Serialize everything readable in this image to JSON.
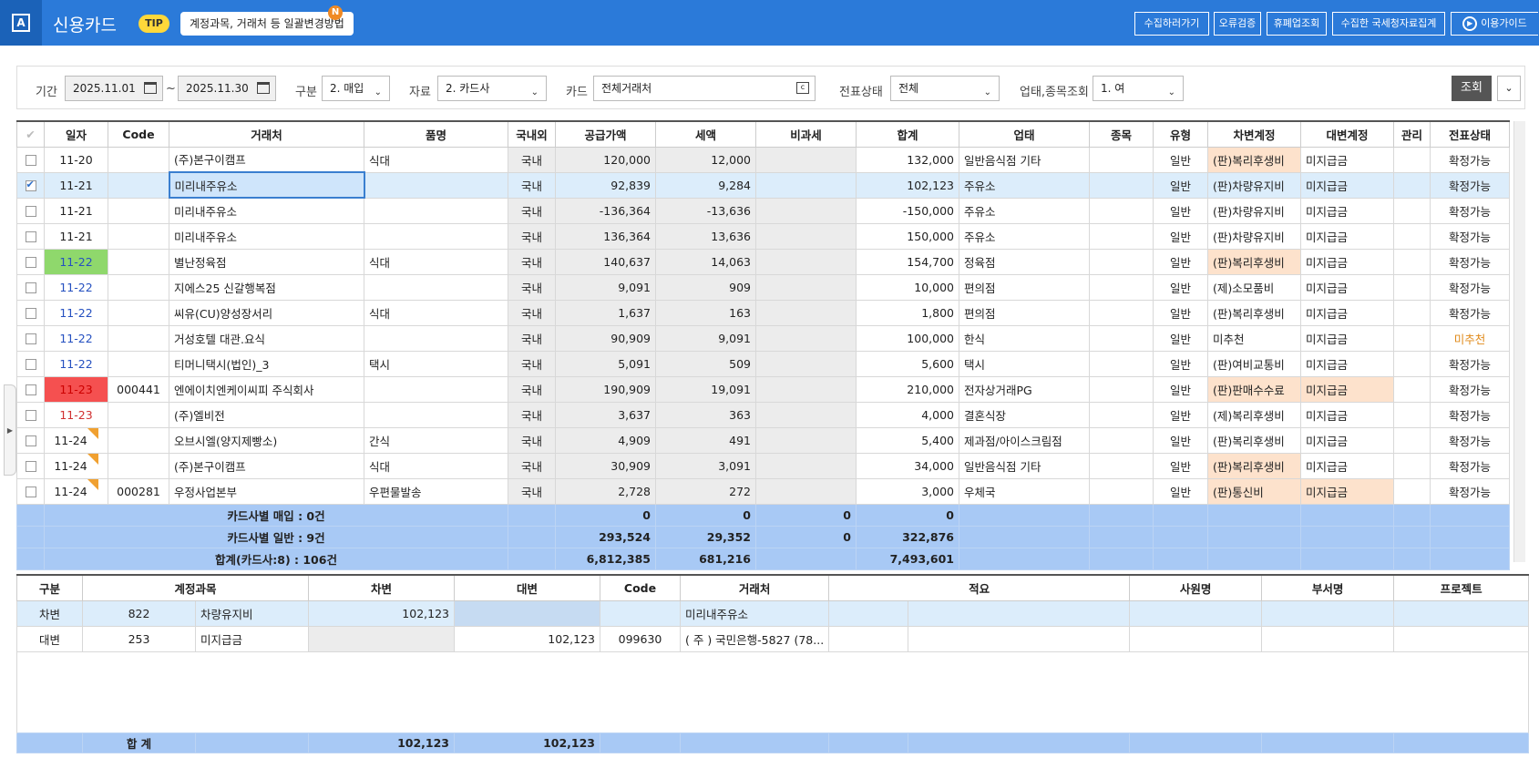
{
  "header": {
    "logo_letter": "A",
    "title": "신용카드",
    "tip_badge": "TIP",
    "tip_text": "계정과목, 거래처 등 일괄변경방법",
    "tip_new": "N",
    "buttons": [
      "수집하러가기",
      "오류검증",
      "휴폐업조회",
      "수집한 국세청자료집계",
      "이용가이드"
    ]
  },
  "filter": {
    "period_label": "기간",
    "date_from": "2025.11.01",
    "date_sep": "~",
    "date_to": "2025.11.30",
    "type_label": "구분",
    "type_value": "2. 매입",
    "source_label": "자료",
    "source_value": "2. 카드사",
    "card_label": "카드",
    "card_value": "전체거래처",
    "status_label": "전표상태",
    "status_value": "전체",
    "industry_label": "업태,종목조회",
    "industry_value": "1. 여",
    "search_button": "조회"
  },
  "grid": {
    "columns": [
      "일자",
      "Code",
      "거래처",
      "품명",
      "국내외",
      "공급가액",
      "세액",
      "비과세",
      "합계",
      "업태",
      "종목",
      "유형",
      "차변계정",
      "대변계정",
      "관리",
      "전표상태"
    ],
    "rows": [
      {
        "date": "11-20",
        "code": "",
        "vendor": "(주)본구이캠프",
        "item": "식대",
        "dom": "국내",
        "supply": "120,000",
        "tax": "12,000",
        "nontax": "",
        "total": "132,000",
        "biz": "일반음식점 기타",
        "kind": "",
        "type": "일반",
        "debit": "(판)복리후생비",
        "credit": "미지급금",
        "mgmt": "",
        "status": "확정가능"
      },
      {
        "date": "11-21",
        "code": "",
        "vendor": "미리내주유소",
        "item": "",
        "dom": "국내",
        "supply": "92,839",
        "tax": "9,284",
        "nontax": "",
        "total": "102,123",
        "biz": "주유소",
        "kind": "",
        "type": "일반",
        "debit": "(판)차량유지비",
        "credit": "미지급금",
        "mgmt": "",
        "status": "확정가능"
      },
      {
        "date": "11-21",
        "code": "",
        "vendor": "미리내주유소",
        "item": "",
        "dom": "국내",
        "supply": "-136,364",
        "tax": "-13,636",
        "nontax": "",
        "total": "-150,000",
        "biz": "주유소",
        "kind": "",
        "type": "일반",
        "debit": "(판)차량유지비",
        "credit": "미지급금",
        "mgmt": "",
        "status": "확정가능"
      },
      {
        "date": "11-21",
        "code": "",
        "vendor": "미리내주유소",
        "item": "",
        "dom": "국내",
        "supply": "136,364",
        "tax": "13,636",
        "nontax": "",
        "total": "150,000",
        "biz": "주유소",
        "kind": "",
        "type": "일반",
        "debit": "(판)차량유지비",
        "credit": "미지급금",
        "mgmt": "",
        "status": "확정가능"
      },
      {
        "date": "11-22",
        "code": "",
        "vendor": "별난정육점",
        "item": "식대",
        "dom": "국내",
        "supply": "140,637",
        "tax": "14,063",
        "nontax": "",
        "total": "154,700",
        "biz": "정육점",
        "kind": "",
        "type": "일반",
        "debit": "(판)복리후생비",
        "credit": "미지급금",
        "mgmt": "",
        "status": "확정가능"
      },
      {
        "date": "11-22",
        "code": "",
        "vendor": "지에스25 신갈행복점",
        "item": "",
        "dom": "국내",
        "supply": "9,091",
        "tax": "909",
        "nontax": "",
        "total": "10,000",
        "biz": "편의점",
        "kind": "",
        "type": "일반",
        "debit": "(제)소모품비",
        "credit": "미지급금",
        "mgmt": "",
        "status": "확정가능"
      },
      {
        "date": "11-22",
        "code": "",
        "vendor": "씨유(CU)양성장서리",
        "item": "식대",
        "dom": "국내",
        "supply": "1,637",
        "tax": "163",
        "nontax": "",
        "total": "1,800",
        "biz": "편의점",
        "kind": "",
        "type": "일반",
        "debit": "(판)복리후생비",
        "credit": "미지급금",
        "mgmt": "",
        "status": "확정가능"
      },
      {
        "date": "11-22",
        "code": "",
        "vendor": "거성호텔 대관.요식",
        "item": "",
        "dom": "국내",
        "supply": "90,909",
        "tax": "9,091",
        "nontax": "",
        "total": "100,000",
        "biz": "한식",
        "kind": "",
        "type": "일반",
        "debit": "미추천",
        "credit": "미지급금",
        "mgmt": "",
        "status": "미추천"
      },
      {
        "date": "11-22",
        "code": "",
        "vendor": "티머니택시(법인)_3",
        "item": "택시",
        "dom": "국내",
        "supply": "5,091",
        "tax": "509",
        "nontax": "",
        "total": "5,600",
        "biz": "택시",
        "kind": "",
        "type": "일반",
        "debit": "(판)여비교통비",
        "credit": "미지급금",
        "mgmt": "",
        "status": "확정가능"
      },
      {
        "date": "11-23",
        "code": "000441",
        "vendor": "엔에이치엔케이씨피 주식회사",
        "item": "",
        "dom": "국내",
        "supply": "190,909",
        "tax": "19,091",
        "nontax": "",
        "total": "210,000",
        "biz": "전자상거래PG",
        "kind": "",
        "type": "일반",
        "debit": "(판)판매수수료",
        "credit": "미지급금",
        "mgmt": "",
        "status": "확정가능"
      },
      {
        "date": "11-23",
        "code": "",
        "vendor": "(주)엘비전",
        "item": "",
        "dom": "국내",
        "supply": "3,637",
        "tax": "363",
        "nontax": "",
        "total": "4,000",
        "biz": "결혼식장",
        "kind": "",
        "type": "일반",
        "debit": "(제)복리후생비",
        "credit": "미지급금",
        "mgmt": "",
        "status": "확정가능"
      },
      {
        "date": "11-24",
        "code": "",
        "vendor": "오브시엘(양지제빵소)",
        "item": "간식",
        "dom": "국내",
        "supply": "4,909",
        "tax": "491",
        "nontax": "",
        "total": "5,400",
        "biz": "제과점/아이스크림점",
        "kind": "",
        "type": "일반",
        "debit": "(판)복리후생비",
        "credit": "미지급금",
        "mgmt": "",
        "status": "확정가능"
      },
      {
        "date": "11-24",
        "code": "",
        "vendor": "(주)본구이캠프",
        "item": "식대",
        "dom": "국내",
        "supply": "30,909",
        "tax": "3,091",
        "nontax": "",
        "total": "34,000",
        "biz": "일반음식점 기타",
        "kind": "",
        "type": "일반",
        "debit": "(판)복리후생비",
        "credit": "미지급금",
        "mgmt": "",
        "status": "확정가능"
      },
      {
        "date": "11-24",
        "code": "000281",
        "vendor": "우정사업본부",
        "item": "우편물발송",
        "dom": "국내",
        "supply": "2,728",
        "tax": "272",
        "nontax": "",
        "total": "3,000",
        "biz": "우체국",
        "kind": "",
        "type": "일반",
        "debit": "(판)통신비",
        "credit": "미지급금",
        "mgmt": "",
        "status": "확정가능"
      }
    ],
    "summary": [
      {
        "label": "카드사별  매입 : 0건",
        "supply": "0",
        "tax": "0",
        "nontax": "0",
        "total": "0"
      },
      {
        "label": "카드사별  일반 : 9건",
        "supply": "293,524",
        "tax": "29,352",
        "nontax": "0",
        "total": "322,876"
      },
      {
        "label": "합계(카드사:8) : 106건",
        "supply": "6,812,385",
        "tax": "681,216",
        "nontax": "",
        "total": "7,493,601"
      }
    ]
  },
  "journal": {
    "columns": [
      "구분",
      "계정과목",
      "차변",
      "대변",
      "Code",
      "거래처",
      "적요",
      "사원명",
      "부서명",
      "프로젝트"
    ],
    "rows": [
      {
        "side": "차변",
        "acct_code": "822",
        "acct_name": "차량유지비",
        "debit": "102,123",
        "credit": "",
        "code": "",
        "vendor": "미리내주유소"
      },
      {
        "side": "대변",
        "acct_code": "253",
        "acct_name": "미지급금",
        "debit": "",
        "credit": "102,123",
        "code": "099630",
        "vendor": "( 주 ) 국민은행-5827 (78..."
      }
    ],
    "total_label": "합  계",
    "total_debit": "102,123",
    "total_credit": "102,123"
  },
  "flag_new": "N"
}
